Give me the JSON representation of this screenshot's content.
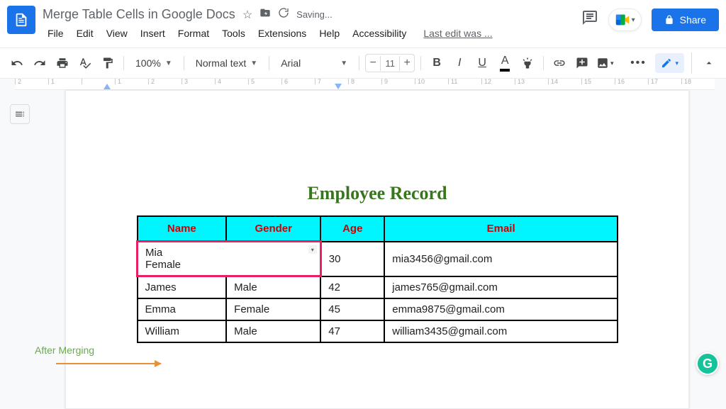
{
  "header": {
    "doc_title": "Merge Table Cells in Google Docs",
    "saving": "Saving...",
    "last_edit": "Last edit was ...",
    "share": "Share"
  },
  "menubar": [
    "File",
    "Edit",
    "View",
    "Insert",
    "Format",
    "Tools",
    "Extensions",
    "Help",
    "Accessibility"
  ],
  "toolbar": {
    "zoom": "100%",
    "style": "Normal text",
    "font": "Arial",
    "fontsize": "11"
  },
  "ruler": [
    "2",
    "1",
    "",
    "1",
    "2",
    "3",
    "4",
    "5",
    "6",
    "7",
    "8",
    "9",
    "10",
    "11",
    "12",
    "13",
    "14",
    "15",
    "16",
    "17",
    "18"
  ],
  "annotation": "After Merging",
  "document": {
    "title": "Employee Record",
    "headers": [
      "Name",
      "Gender",
      "Age",
      "Email"
    ],
    "merged": {
      "line1": "Mia",
      "line2": "Female"
    },
    "row1_age": "30",
    "row1_email": "mia3456@gmail.com",
    "rows": [
      {
        "name": "James",
        "gender": "Male",
        "age": "42",
        "email": "james765@gmail.com"
      },
      {
        "name": "Emma",
        "gender": "Female",
        "age": "45",
        "email": "emma9875@gmail.com"
      },
      {
        "name": "William",
        "gender": "Male",
        "age": "47",
        "email": "william3435@gmail.com"
      }
    ]
  },
  "grammarly": "G"
}
